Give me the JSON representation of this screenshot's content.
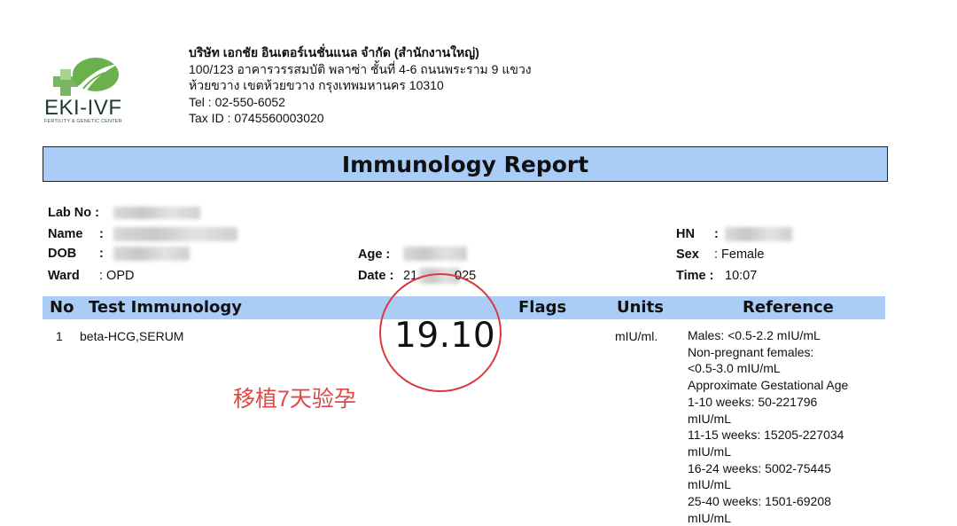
{
  "logo": {
    "name": "EKI-IVF",
    "subtitle": "FERTILITY & GENETIC CENTER"
  },
  "company": {
    "name": "บริษัท เอกชัย อินเตอร์เนชั่นแนล จำกัด (สำนักงานใหญ่)",
    "address1": "100/123 อาคารวรรสมบัติ พลาซ่า  ชั้นที่ 4-6 ถนนพระราม 9 แขวง",
    "address2": "ห้วยขวาง เขตห้วยขวาง กรุงเทพมหานคร 10310",
    "tel": "Tel : 02-550-6052",
    "tax": "Tax ID : 0745560003020"
  },
  "report_title": "Immunology Report",
  "patient": {
    "lab_no_label": "Lab No :",
    "name_label": "Name",
    "dob_label": "DOB",
    "ward_label": "Ward",
    "ward_value": ": OPD",
    "age_label": "Age :",
    "date_label": "Date :",
    "date_value": "21.",
    "date_tail": "025",
    "hn_label": "HN",
    "sex_label": "Sex",
    "sex_value": ": Female",
    "time_label": "Time :",
    "time_value": "10:07",
    "colon": ":"
  },
  "table": {
    "headers": {
      "no": "No",
      "test": "Test Immunology",
      "flags": "Flags",
      "units": "Units",
      "reference": "Reference"
    },
    "row": {
      "no": "1",
      "test": "beta-HCG,SERUM",
      "result": "19.10",
      "units": "mIU/ml.",
      "reference": [
        "Males: <0.5-2.2 mIU/mL",
        "Non-pregnant females:",
        "<0.5-3.0 mIU/mL",
        "Approximate Gestational Age",
        "1-10 weeks: 50-221796",
        "mIU/mL",
        "11-15 weeks: 15205-227034",
        "mIU/mL",
        "16-24 weeks: 5002-75445",
        "mIU/mL",
        "25-40 weeks: 1501-69208",
        "mIU/mL"
      ]
    }
  },
  "annotation": "移植7天验孕",
  "colors": {
    "header_bg": "#a9cdf7",
    "annotation": "#dc4a46",
    "logo_green": "#6ab04c"
  }
}
